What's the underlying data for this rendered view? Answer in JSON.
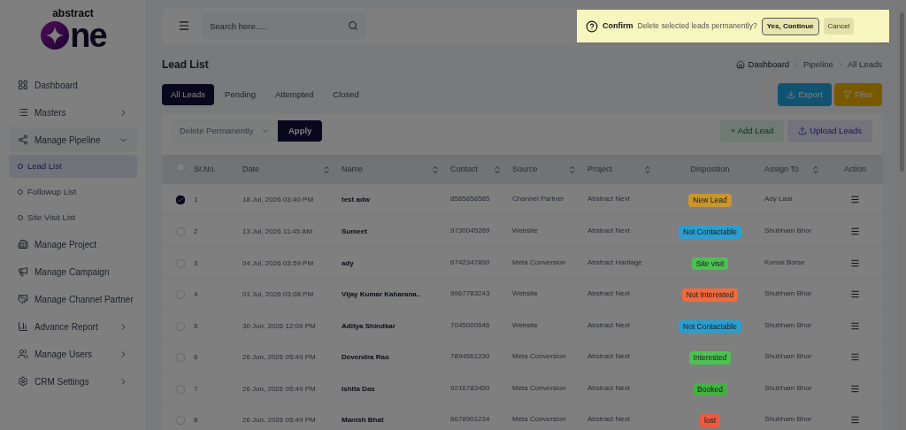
{
  "logo": {
    "top": "abstract",
    "bottom": "ne"
  },
  "sidebar": {
    "items": [
      {
        "label": "Dashboard"
      },
      {
        "label": "Masters",
        "expanded": false
      },
      {
        "label": "Manage Pipeline",
        "expanded": true,
        "children": [
          {
            "label": "Lead List",
            "selected": true
          },
          {
            "label": "Followup List",
            "selected": false
          },
          {
            "label": "Site Visit List",
            "selected": false
          }
        ]
      },
      {
        "label": "Manage Project"
      },
      {
        "label": "Manage Campaign"
      },
      {
        "label": "Manage Channel Partner"
      },
      {
        "label": "Advance Report",
        "expanded": false
      },
      {
        "label": "Manage Users",
        "expanded": false
      },
      {
        "label": "CRM Settings",
        "expanded": false
      }
    ]
  },
  "search": {
    "placeholder": "Search here....."
  },
  "page_title": "Lead List",
  "breadcrumb": [
    "Dashboard",
    "Pipeline",
    "All Leads"
  ],
  "tabs": [
    {
      "label": "All Leads",
      "selected": true
    },
    {
      "label": "Pending",
      "selected": false
    },
    {
      "label": "Attempted",
      "selected": false
    },
    {
      "label": "Closed",
      "selected": false
    }
  ],
  "export_button": "Export",
  "filter_button": "Filter",
  "bulk_action": {
    "value": "Delete Permanently",
    "apply": "Apply"
  },
  "add_lead_button": "+ Add Lead",
  "upload_button": "Upload Leads",
  "table": {
    "select_all": {
      "checked": false
    },
    "columns": [
      {
        "label": "Sr.No.",
        "sortable": false
      },
      {
        "label": "Date",
        "sortable": true
      },
      {
        "label": "Name",
        "sortable": true
      },
      {
        "label": "Contact",
        "sortable": true
      },
      {
        "label": "Source",
        "sortable": true
      },
      {
        "label": "Project",
        "sortable": true
      },
      {
        "label": "Disposition",
        "sortable": false
      },
      {
        "label": "Assign To",
        "sortable": true
      },
      {
        "label": "Action",
        "sortable": false
      }
    ],
    "rows": [
      {
        "checked": true,
        "sr": "1",
        "date": "18 Jul, 2026 03:40 PM",
        "name": "test adw",
        "contact": "8585858585",
        "source": "Channel Partner",
        "project": "Abstract Next",
        "disposition": {
          "label": "New Lead",
          "color": "#c9962e"
        },
        "assign_to": "Ady Laal"
      },
      {
        "checked": false,
        "sr": "2",
        "date": "13 Jul, 2026 11:45 AM",
        "name": "Sumeet",
        "contact": "9730045269",
        "source": "Website",
        "project": "Abstract Next",
        "disposition": {
          "label": "Not Contactable",
          "color": "#2a9fcf"
        },
        "assign_to": "Shubham Bhor"
      },
      {
        "checked": false,
        "sr": "3",
        "date": "04 Jul, 2026 03:59 PM",
        "name": "ady",
        "contact": "6742347890",
        "source": "Meta Conversion",
        "project": "Abstract Haritage",
        "disposition": {
          "label": "Site visit",
          "color": "#4cc253"
        },
        "assign_to": "Komal Borse"
      },
      {
        "checked": false,
        "sr": "4",
        "date": "01 Jul, 2026 03:08 PM",
        "name": "Vijay Kumar Kaharana..",
        "contact": "9967783243",
        "source": "Website",
        "project": "Abstract Next",
        "disposition": {
          "label": "Not Interested",
          "color": "#ee6a40"
        },
        "assign_to": "Shubham Bhor"
      },
      {
        "checked": false,
        "sr": "5",
        "date": "30 Jun, 2026 12:09 PM",
        "name": "Aditya Shindkar",
        "contact": "7045000646",
        "source": "Website",
        "project": "Abstract Next",
        "disposition": {
          "label": "Not Contactable",
          "color": "#2a9fcf"
        },
        "assign_to": "Shubham Bhor"
      },
      {
        "checked": false,
        "sr": "6",
        "date": "26 Jun, 2026 05:49 PM",
        "name": "Devendra Rao",
        "contact": "7894561230",
        "source": "Meta Conversion",
        "project": "Abstract Next",
        "disposition": {
          "label": "Interested",
          "color": "#4cc253"
        },
        "assign_to": "Shubham Bhor"
      },
      {
        "checked": false,
        "sr": "7",
        "date": "26 Jun, 2026 05:49 PM",
        "name": "Ishita Das",
        "contact": "9216783450",
        "source": "Meta Conversion",
        "project": "Abstract Next",
        "disposition": {
          "label": "Booked",
          "color": "#45b045"
        },
        "assign_to": "Shubham Bhor"
      },
      {
        "checked": false,
        "sr": "8",
        "date": "26 Jun, 2026 05:49 PM",
        "name": "Manish Bhat",
        "contact": "6678901234",
        "source": "Meta Conversion",
        "project": "Abstract Next",
        "disposition": {
          "label": "lost",
          "color": "#ee5a3f"
        },
        "assign_to": "Shubham Bhor"
      }
    ]
  },
  "confirm": {
    "title": "Confirm",
    "message": "Delete selected leads permanently?",
    "yes": "Yes, Continue",
    "cancel": "Cancel"
  }
}
